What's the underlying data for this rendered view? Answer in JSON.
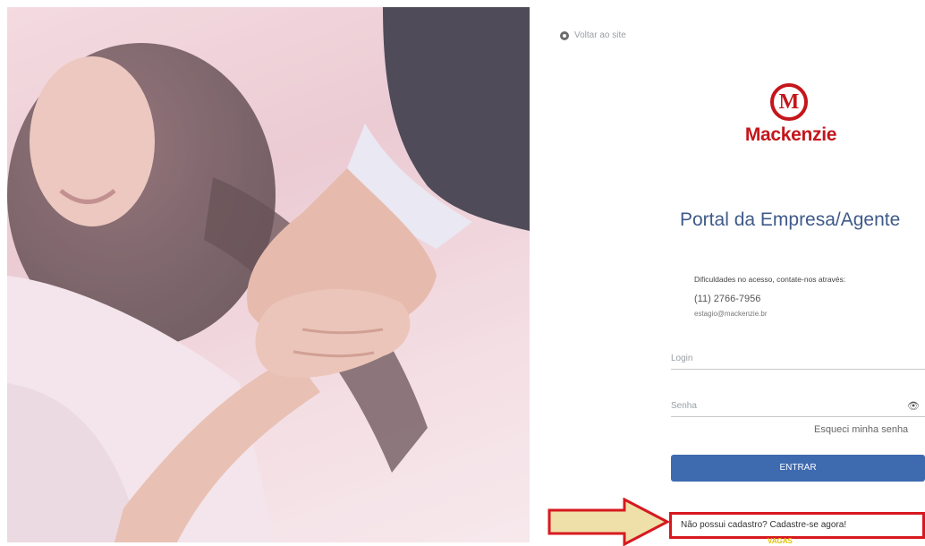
{
  "back_link": {
    "label": "Voltar ao site"
  },
  "brand": {
    "letter": "M",
    "name": "Mackenzie"
  },
  "portal": {
    "title": "Portal da Empresa/Agente"
  },
  "contact": {
    "intro": "Dificuldades no acesso, contate-nos através:",
    "phone": "(11) 2766-7956",
    "email": "estagio@mackenzie.br"
  },
  "form": {
    "login_placeholder": "Login",
    "password_placeholder": "Senha",
    "forgot_label": "Esqueci minha senha",
    "submit_label": "ENTRAR"
  },
  "register": {
    "label": "Não possui cadastro? Cadastre-se agora!"
  },
  "footer": {
    "logo_text": "VAGAS"
  },
  "colors": {
    "brand_red": "#c4161c",
    "button_blue": "#3e6ab0",
    "title_blue": "#3f5a8a",
    "arrow_fill": "#eee0a8"
  }
}
